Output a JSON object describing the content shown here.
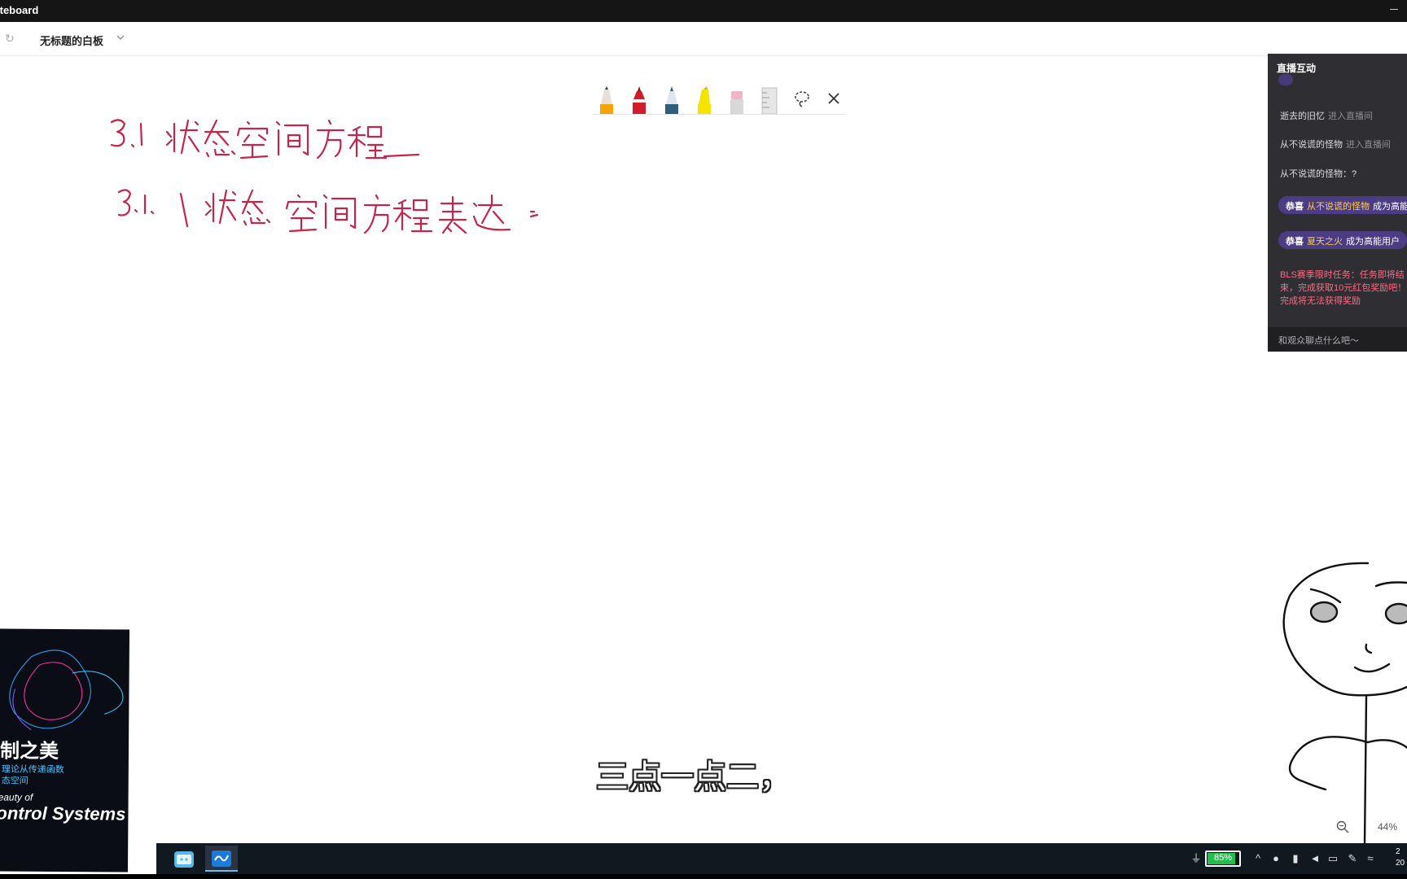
{
  "window": {
    "title": "iteboard"
  },
  "header": {
    "doc_title": "无标题的白板"
  },
  "board": {
    "handwriting": [
      "3.1 状态空间方程",
      "3.1.1 状态空间方程表达："
    ],
    "ink_color": "#c4254a"
  },
  "pens": [
    {
      "name": "pencil-orange",
      "color": "#f2a400"
    },
    {
      "name": "marker-red",
      "color": "#d01c2b"
    },
    {
      "name": "pen-blue",
      "color": "#2f5e7a"
    },
    {
      "name": "highlighter-yellow",
      "color": "#f6e400"
    },
    {
      "name": "eraser",
      "color": "#f1b5c4"
    },
    {
      "name": "ruler",
      "color": "#bfbfbf"
    }
  ],
  "chat": {
    "title": "直播互动",
    "messages": [
      {
        "user": "逝去的旧忆",
        "action": "进入直播间"
      },
      {
        "user": "从不说谎的怪物",
        "action": "进入直播间"
      },
      {
        "user": "从不说谎的怪物：",
        "action": "?"
      }
    ],
    "pills": [
      {
        "prefix": "恭喜",
        "user": "从不说谎的怪物",
        "text": "成为高能用户"
      },
      {
        "prefix": "恭喜",
        "user": "夏天之火",
        "text": "成为高能用户"
      }
    ],
    "notice": "BLS赛季限时任务：任务即将结束，完成获取10元红包奖励吧！未完成将无法获得奖励",
    "input_placeholder": "和观众聊点什么吧～"
  },
  "book": {
    "title_cn": "制之美",
    "subtitle_cn": "理论从传递函数\n态空间",
    "title_en_1": "eauty of",
    "title_en_2": "ontrol Systems"
  },
  "subtitle": "三点一点二，",
  "zoom": {
    "level": "44%"
  },
  "tray": {
    "battery": "85%",
    "battery_level": 0.85,
    "clock_partial": "2\n20"
  }
}
